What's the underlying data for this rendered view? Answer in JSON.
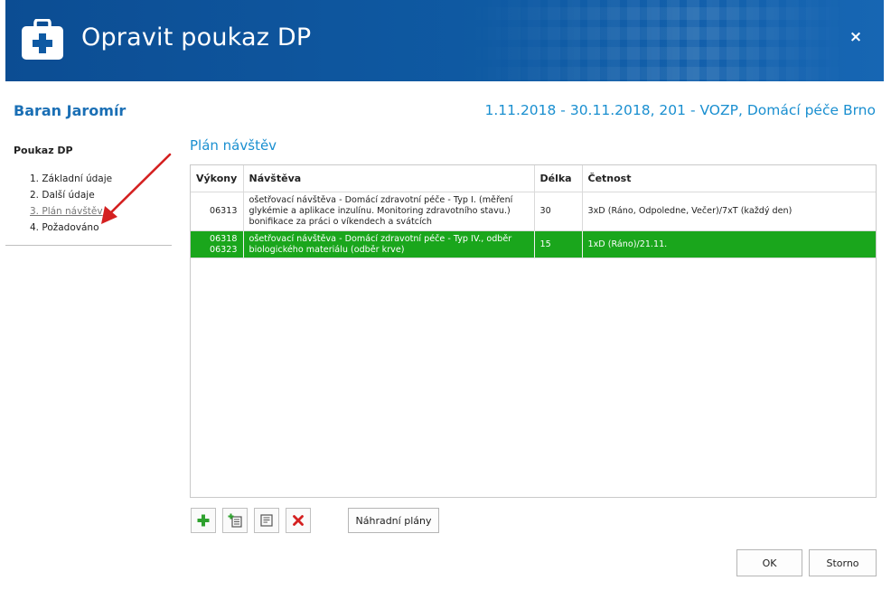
{
  "dialog": {
    "title": "Opravit poukaz DP",
    "close_glyph": "×",
    "header_color": "#0f5aa3",
    "icon": "medical-kit-icon"
  },
  "patient": {
    "name": "Baran Jaromír",
    "range": "1.11.2018 - 30.11.2018, 201 - VOZP, Domácí péče Brno"
  },
  "nav": {
    "title": "Poukaz DP",
    "items": [
      {
        "label": "1. Základní údaje"
      },
      {
        "label": "2. Další údaje"
      },
      {
        "label": "3. Plán návštěv"
      },
      {
        "label": "4. Požadováno"
      }
    ],
    "active_index": 2
  },
  "plan": {
    "section_title": "Plán návštěv",
    "columns": [
      "Výkony",
      "Návštěva",
      "Délka",
      "Četnost"
    ],
    "rows": [
      {
        "codes": [
          "06313"
        ],
        "visit": "ošetřovací návštěva - Domácí zdravotní péče - Typ I. (měření glykémie a aplikace inzulínu. Monitoring zdravotního stavu.) bonifikace za práci o víkendech a svátcích",
        "length": "30",
        "frequency": "3xD (Ráno, Odpoledne, Večer)/7xT (každý den)",
        "selected": false
      },
      {
        "codes": [
          "06318",
          "06323"
        ],
        "visit": "ošetřovací návštěva - Domácí zdravotní péče - Typ IV., odběr biologického materiálu (odběr krve)",
        "length": "15",
        "frequency": "1xD (Ráno)/21.11.",
        "selected": true
      }
    ],
    "selected_row_color": "#1aa61c"
  },
  "toolbar": {
    "add_icon": "plus-icon",
    "copy_icon": "copy-list-icon",
    "edit_icon": "edit-note-icon",
    "delete_icon": "delete-x-icon",
    "alt_plans_label": "Náhradní plány"
  },
  "footer": {
    "ok_label": "OK",
    "cancel_label": "Storno"
  },
  "annotation": {
    "arrow_color": "#d42020"
  }
}
